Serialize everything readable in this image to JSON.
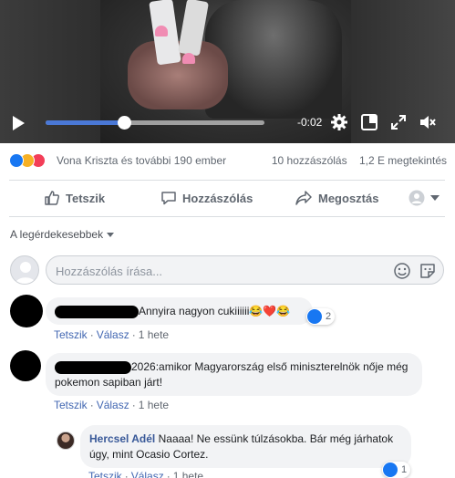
{
  "video": {
    "time_remaining": "-0:02",
    "progress": 0.36
  },
  "stats": {
    "reactions_text": "Vona Kriszta és további 190 ember",
    "comments_count": "10 hozzászólás",
    "views": "1,2 E megtekintés",
    "reaction_colors": {
      "like": "#1877f2",
      "haha": "#f7b125",
      "love": "#f33e58"
    }
  },
  "actions": {
    "like": "Tetszik",
    "comment": "Hozzászólás",
    "share": "Megosztás"
  },
  "sort_label": "A legérdekesebbek",
  "composer": {
    "placeholder": "Hozzászólás írása..."
  },
  "comments": [
    {
      "author": "",
      "text": "Annyira nagyon cukiiiiii😂❤️😂",
      "like_label": "Tetszik",
      "reply_label": "Válasz",
      "time": "1 hete",
      "reactions": "2"
    },
    {
      "author": "",
      "text": "2026:amikor Magyarország első miniszterelnök nője még pokemon sapiban járt!",
      "like_label": "Tetszik",
      "reply_label": "Válasz",
      "time": "1 hete"
    },
    {
      "author": "Hercsel Adél",
      "text": "Naaaa! Ne essünk túlzásokba. Bár még járhatok úgy, mint Ocasio Cortez.",
      "like_label": "Tetszik",
      "reply_label": "Válasz",
      "time": "1 hete",
      "reactions": "1"
    }
  ],
  "colors": {
    "link": "#4267b2",
    "author": "#385898",
    "muted": "#606770",
    "bubble": "#f2f3f5",
    "accent": "#4a78d6"
  }
}
